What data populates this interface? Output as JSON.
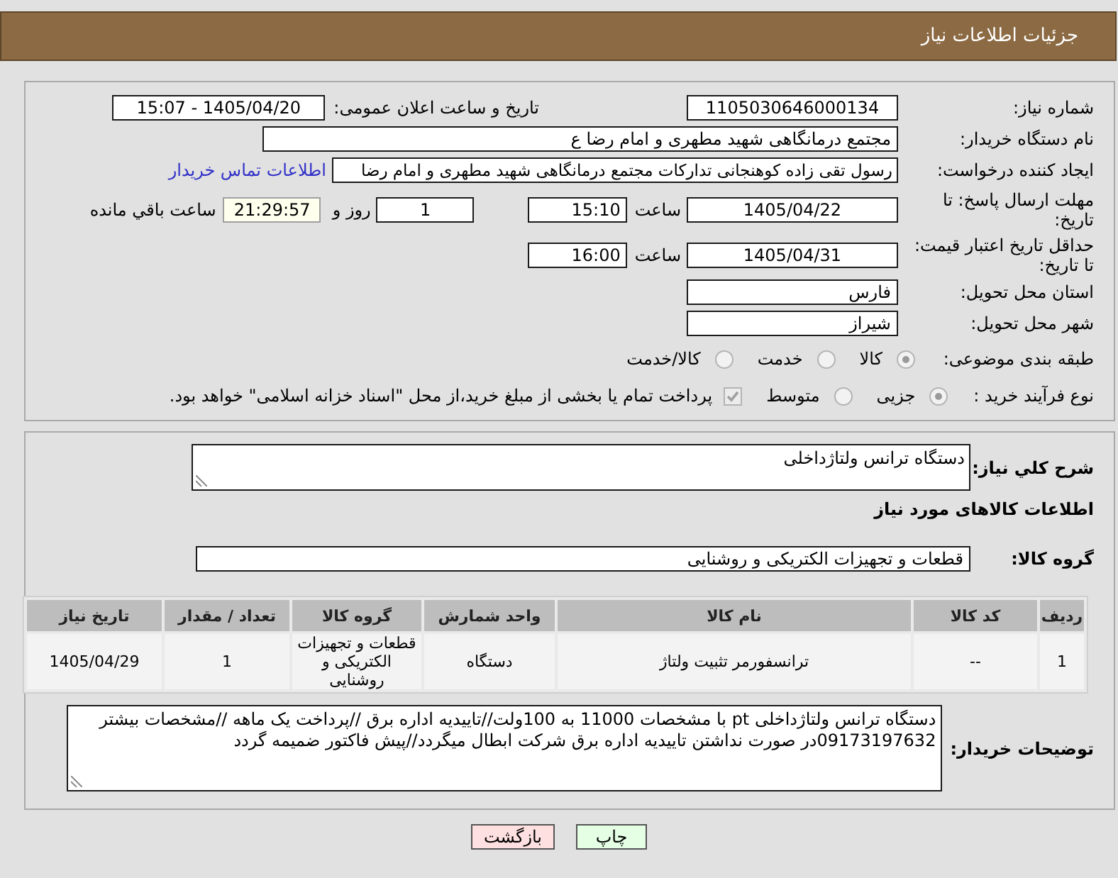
{
  "header": {
    "title": "جزئیات اطلاعات نیاز"
  },
  "summary": {
    "need_number": {
      "label": "شماره نیاز:",
      "value": "1105030646000134"
    },
    "announce": {
      "label": "تاریخ و ساعت اعلان عمومی:",
      "value": "1405/04/20 - 15:07"
    },
    "buyer": {
      "label": "نام دستگاه خریدار:",
      "value": "مجتمع درمانگاهی شهید مطهری و امام رضا  ع"
    },
    "requester": {
      "label": "ایجاد کننده درخواست:",
      "value": "رسول تقی زاده کوهنجانی تدارکات مجتمع درمانگاهی شهید مطهری و امام رضا",
      "link": "اطلاعات تماس خریدار"
    },
    "reply_deadline": {
      "label": "مهلت ارسال پاسخ: تا تاریخ:",
      "date": "1405/04/22",
      "time_label": "ساعت",
      "time": "15:10",
      "days": "1",
      "days_label": "روز و",
      "remaining": "21:29:57",
      "remaining_label": "ساعت باقي مانده"
    },
    "price_validity": {
      "label": "حداقل تاریخ اعتبار قیمت: تا تاریخ:",
      "date": "1405/04/31",
      "time_label": "ساعت",
      "time": "16:00"
    },
    "province": {
      "label": "استان محل تحویل:",
      "value": "فارس"
    },
    "city": {
      "label": "شهر محل تحویل:",
      "value": "شیراز"
    },
    "category": {
      "label": "طبقه بندی موضوعی:",
      "disabled": true,
      "options": [
        {
          "label": "کالا",
          "selected": true
        },
        {
          "label": "خدمت",
          "selected": false
        },
        {
          "label": "کالا/خدمت",
          "selected": false
        }
      ]
    },
    "process": {
      "label": "نوع فرآیند خرید :",
      "disabled": true,
      "options": [
        {
          "label": "جزیی",
          "selected": true
        },
        {
          "label": "متوسط",
          "selected": false
        }
      ],
      "treasury": {
        "label": "پرداخت تمام یا بخشی از مبلغ خرید،از محل \"اسناد خزانه اسلامی\" خواهد بود.",
        "checked": true
      }
    }
  },
  "goods": {
    "description": {
      "label": "شرح کلي نیاز:",
      "value": "دستگاه ترانس ولتاژداخلی"
    },
    "section_title": "اطلاعات کالاهای مورد نیاز",
    "group": {
      "label": "گروه کالا:",
      "value": "قطعات و تجهیزات الکتریکی و روشنایی"
    },
    "table": {
      "columns": [
        "ردیف",
        "کد کالا",
        "نام کالا",
        "واحد شمارش",
        "گروه کالا",
        "تعداد / مقدار",
        "تاریخ نیاز"
      ],
      "rows": [
        [
          "1",
          "--",
          "ترانسفورمر تثبیت ولتاژ",
          "دستگاه",
          "قطعات و تجهیزات الکتریکی و روشنایی",
          "1",
          "1405/04/29"
        ]
      ]
    },
    "buyer_notes": {
      "label": "توضیحات خریدار:",
      "value": "دستگاه ترانس ولتاژداخلی pt با مشخصات 11000 به 100ولت//تاییدیه اداره برق //پرداخت یک ماهه //مشخصات بیشتر 09173197632در صورت نداشتن تاییدیه اداره برق شرکت ابطال میگردد//پیش فاکتور ضمیمه گردد"
    }
  },
  "buttons": [
    {
      "label": "چاپ",
      "kind": "print"
    },
    {
      "label": "بازگشت",
      "kind": "back"
    }
  ]
}
